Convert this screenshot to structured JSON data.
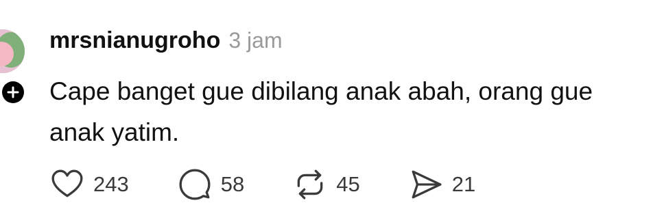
{
  "post": {
    "username": "mrsnianugroho",
    "timestamp": "3 jam",
    "text": "Cape banget gue dibilang anak abah, orang gue anak yatim."
  },
  "actions": {
    "like": {
      "icon": "heart-icon",
      "count": "243"
    },
    "reply": {
      "icon": "comment-icon",
      "count": "58"
    },
    "repost": {
      "icon": "repost-icon",
      "count": "45"
    },
    "share": {
      "icon": "send-icon",
      "count": "21"
    }
  },
  "colors": {
    "text": "#111111",
    "muted": "#9a9a9a",
    "icon": "#3a3a3a",
    "avatar_bg": "#e7c1d1"
  }
}
